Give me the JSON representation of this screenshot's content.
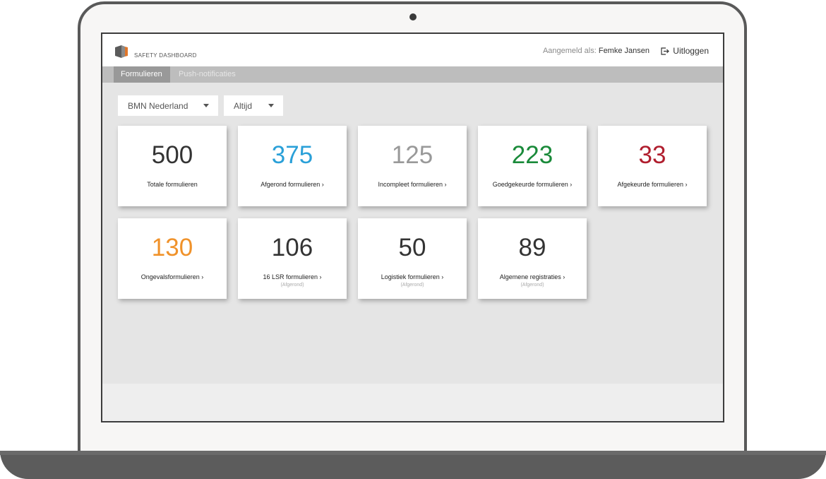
{
  "header": {
    "brand": "SAFETY DASHBOARD",
    "user_prefix": "Aangemeld als:",
    "user_name": "Femke Jansen",
    "logout_label": "Uitloggen"
  },
  "nav": {
    "tabs": [
      {
        "label": "Formulieren",
        "active": true
      },
      {
        "label": "Push-notificaties",
        "active": false
      }
    ]
  },
  "filters": {
    "organisation": "BMN Nederland",
    "period": "Altijd"
  },
  "cards": [
    {
      "value": "500",
      "label": "Totale formulieren",
      "color": "#333333"
    },
    {
      "value": "375",
      "label": "Afgerond formulieren ›",
      "color": "#2aa0d8"
    },
    {
      "value": "125",
      "label": "Incompleet formulieren ›",
      "color": "#999999"
    },
    {
      "value": "223",
      "label": "Goedgekeurde formulieren ›",
      "color": "#1a8a3a"
    },
    {
      "value": "33",
      "label": "Afgekeurde formulieren ›",
      "color": "#b01e2e"
    },
    {
      "value": "130",
      "label": "Ongevalsformulieren ›",
      "color": "#f0922a"
    },
    {
      "value": "106",
      "label": "16 LSR formulieren ›",
      "sub": "(Afgerond)",
      "color": "#333333"
    },
    {
      "value": "50",
      "label": "Logistiek formulieren ›",
      "sub": "(Afgerond)",
      "color": "#333333"
    },
    {
      "value": "89",
      "label": "Algemene registraties ›",
      "sub": "(Afgerond)",
      "color": "#333333"
    }
  ],
  "icons": {
    "logo": "safety-dashboard-logo",
    "logout": "logout-icon",
    "dropdown": "chevron-down-icon"
  }
}
